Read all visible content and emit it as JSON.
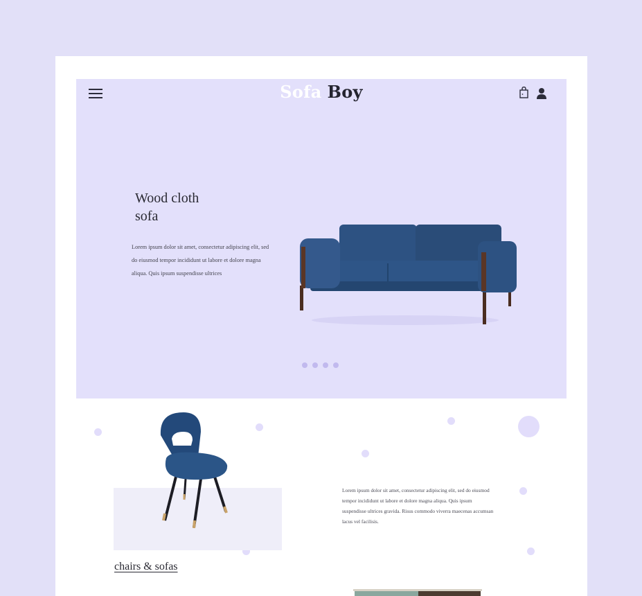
{
  "header": {
    "logo_part1": "Sofa",
    "logo_part2": "Boy",
    "icons": [
      "menu-icon",
      "shopping-bag-icon",
      "user-icon"
    ]
  },
  "hero": {
    "title_line1": "Wood cloth",
    "title_line2": "sofa",
    "description": "Lorem ipsum dolor sit amet, consectetur adipiscing elit, sed do eiusmod tempor incididunt ut labore et dolore magna aliqua. Quis ipsum suspendisse ultrices",
    "slide_count": 4
  },
  "section": {
    "category_link": "chairs & sofas",
    "description": "Lorem ipsum dolor sit amet, consectetur adipiscing elit, sed do eiusmod tempor incididunt ut labore et dolore magna aliqua. Quis ipsum suspendisse ultrices gravida. Risus commodo viverra maecenas accumsan lacus vel facilisis."
  },
  "colors": {
    "page_background": "#e2e0f8",
    "hero_background": "#e3e0fb",
    "accent_dots": "#c1b9ee",
    "sofa_blue": "#2a4c78",
    "text_dark": "#24242f"
  }
}
